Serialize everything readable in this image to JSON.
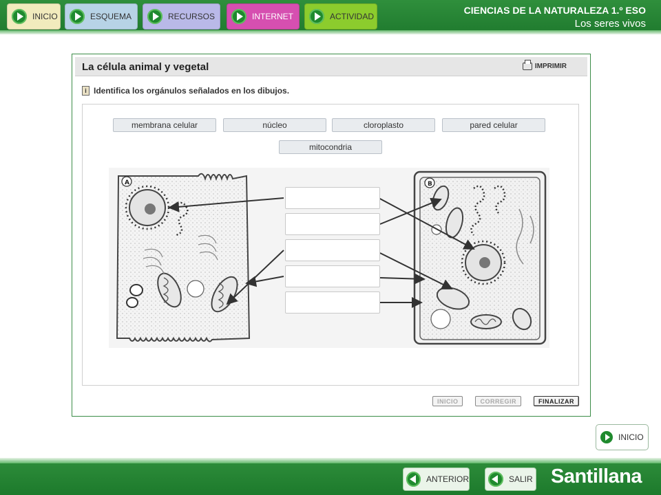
{
  "nav": {
    "inicio": "INICIO",
    "esquema": "ESQUEMA",
    "recursos": "RECURSOS",
    "internet": "INTERNET",
    "actividad": "ACTIVIDAD"
  },
  "course": {
    "title": "CIENCIAS DE LA NATURALEZA 1.º ESO",
    "subtitle": "Los seres vivos"
  },
  "activity": {
    "title": "La célula animal y vegetal",
    "print_label": "IMPRIMIR",
    "instruction": "Identifica los orgánulos señalados en los dibujos.",
    "info_icon": "i",
    "chips": [
      "membrana celular",
      "núcleo",
      "cloroplasto",
      "pared celular",
      "mitocondria"
    ],
    "cell_labels": {
      "animal": "A",
      "plant": "B"
    },
    "buttons": {
      "inicio": "INICIO",
      "corregir": "CORREGIR",
      "finalizar": "FINALIZAR"
    }
  },
  "side": {
    "inicio": "INICIO"
  },
  "footer": {
    "anterior": "ANTERIOR",
    "salir": "SALIR",
    "brand": "Santillana"
  },
  "colors": {
    "header_green": "#1f7a2e",
    "internet_pink": "#d64fb0",
    "actividad_green": "#8ccc2d"
  },
  "icons": {
    "nav": "play-icon",
    "print": "printer-icon",
    "info": "info-icon",
    "footer": "back-arrow-icon"
  }
}
